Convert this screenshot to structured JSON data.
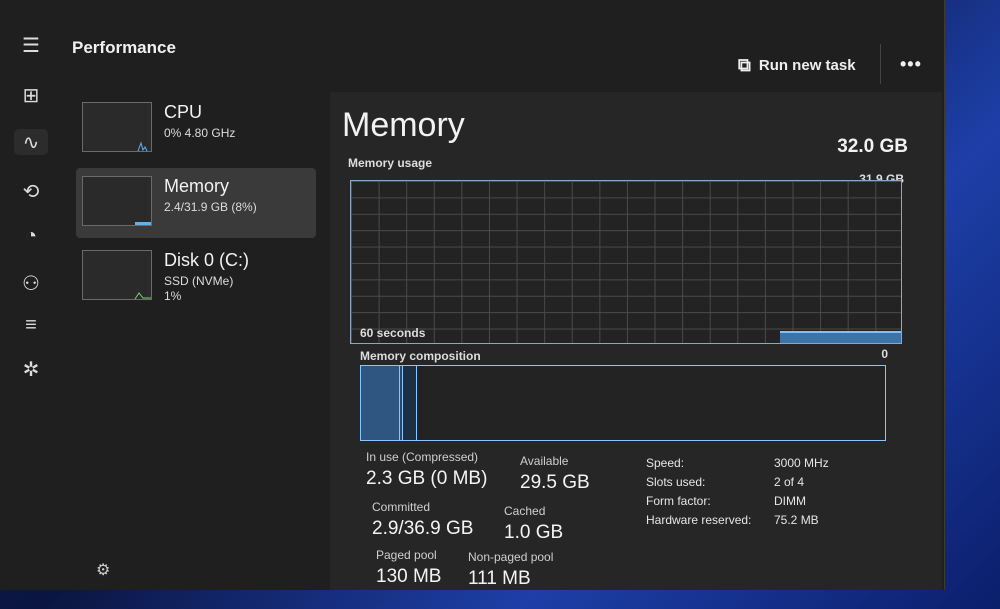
{
  "app": {
    "title": "Performance"
  },
  "toolbar": {
    "run_new_task_label": "Run new task",
    "more_label": "•••"
  },
  "nav": {
    "items": [
      {
        "name": "hamburger-menu-icon",
        "glyph": "☰"
      },
      {
        "name": "processes-icon",
        "glyph": "⊞"
      },
      {
        "name": "performance-icon",
        "glyph": "∿"
      },
      {
        "name": "app-history-icon",
        "glyph": "⟲"
      },
      {
        "name": "startup-apps-icon",
        "glyph": "◔"
      },
      {
        "name": "users-icon",
        "glyph": "⚇"
      },
      {
        "name": "details-icon",
        "glyph": "≡"
      },
      {
        "name": "services-icon",
        "glyph": "✲"
      }
    ],
    "settings_glyph": "⚙"
  },
  "perf_list": [
    {
      "name": "CPU",
      "detail": "0% 4.80 GHz",
      "detail2": ""
    },
    {
      "name": "Memory",
      "detail": "2.4/31.9 GB (8%)",
      "detail2": ""
    },
    {
      "name": "Disk 0 (C:)",
      "detail": "SSD (NVMe)",
      "detail2": "1%"
    }
  ],
  "memory": {
    "title": "Memory",
    "total": "32.0 GB",
    "usage_label": "Memory usage",
    "usage_max": "31.9 GB",
    "seconds_label": "60 seconds",
    "zero_label": "0",
    "composition_label": "Memory composition",
    "composition": {
      "in_use_fraction": 0.075,
      "modified_fraction": 0.005,
      "standby_fraction": 0.027
    },
    "usage_fraction": 0.075
  },
  "stats": {
    "in_use": {
      "label": "In use (Compressed)",
      "value": "2.3 GB (0 MB)"
    },
    "available": {
      "label": "Available",
      "value": "29.5 GB"
    },
    "committed": {
      "label": "Committed",
      "value": "2.9/36.9 GB"
    },
    "cached": {
      "label": "Cached",
      "value": "1.0 GB"
    },
    "paged_pool": {
      "label": "Paged pool",
      "value": "130 MB"
    },
    "non_paged_pool": {
      "label": "Non-paged pool",
      "value": "111 MB"
    }
  },
  "specs": [
    {
      "key": "Speed:",
      "value": "3000 MHz"
    },
    {
      "key": "Slots used:",
      "value": "2 of 4"
    },
    {
      "key": "Form factor:",
      "value": "DIMM"
    },
    {
      "key": "Hardware reserved:",
      "value": "75.2 MB"
    }
  ],
  "colors": {
    "accent": "#5fb2f2",
    "graph_fill": "#3d74a8",
    "graph_line": "#7cc0ff"
  }
}
